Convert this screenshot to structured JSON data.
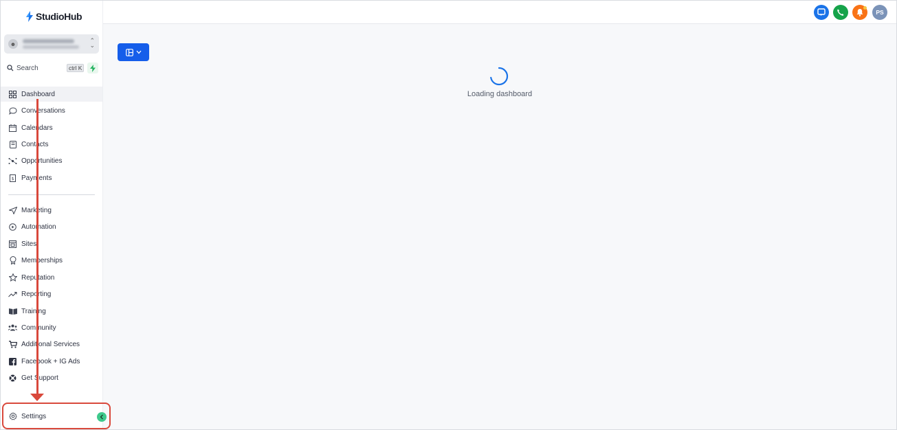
{
  "app": {
    "name": "StudioHub"
  },
  "account": {
    "avatar_icon": "user-icon"
  },
  "search": {
    "label": "Search",
    "shortcut": "ctrl K"
  },
  "nav": {
    "primary": [
      {
        "label": "Dashboard",
        "icon": "dashboard-icon",
        "active": true
      },
      {
        "label": "Conversations",
        "icon": "chat-bubble-icon"
      },
      {
        "label": "Calendars",
        "icon": "calendar-icon"
      },
      {
        "label": "Contacts",
        "icon": "contact-card-icon"
      },
      {
        "label": "Opportunities",
        "icon": "network-icon"
      },
      {
        "label": "Payments",
        "icon": "receipt-icon"
      }
    ],
    "secondary": [
      {
        "label": "Marketing",
        "icon": "send-icon"
      },
      {
        "label": "Automation",
        "icon": "automation-icon"
      },
      {
        "label": "Sites",
        "icon": "sites-icon"
      },
      {
        "label": "Memberships",
        "icon": "award-icon"
      },
      {
        "label": "Reputation",
        "icon": "star-icon"
      },
      {
        "label": "Reporting",
        "icon": "trend-icon"
      },
      {
        "label": "Training",
        "icon": "book-icon"
      },
      {
        "label": "Community",
        "icon": "people-icon"
      },
      {
        "label": "Additional Services",
        "icon": "cart-icon"
      },
      {
        "label": "Facebook + IG Ads",
        "icon": "facebook-icon"
      },
      {
        "label": "Get Support",
        "icon": "lifebuoy-icon"
      }
    ],
    "settings": {
      "label": "Settings",
      "icon": "gear-icon"
    }
  },
  "header": {
    "user_initials": "PS",
    "colors": {
      "chat": "#1a73e8",
      "phone": "#16a34a",
      "bell": "#f97316",
      "avatar": "#7b93b8"
    }
  },
  "main": {
    "loading_text": "Loading dashboard"
  },
  "colors": {
    "primary": "#155eea",
    "annotation": "#d9483b",
    "accent_green": "#3ec98c"
  }
}
